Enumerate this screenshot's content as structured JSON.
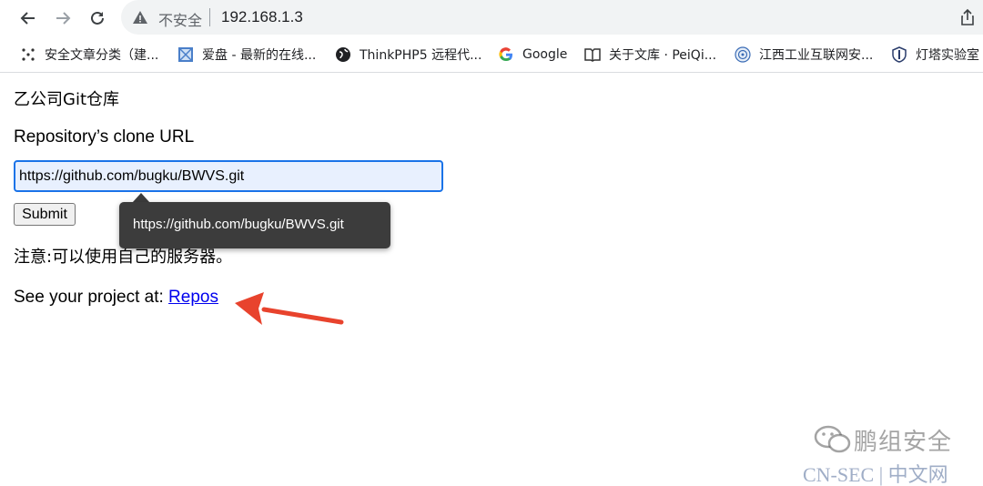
{
  "browser": {
    "security_label": "不安全",
    "address": "192.168.1.3",
    "icons": {
      "back": "arrow-left-icon",
      "forward": "arrow-right-icon",
      "reload": "reload-icon",
      "security": "warning-triangle-icon",
      "share": "share-icon"
    }
  },
  "bookmarks": [
    {
      "label": "安全文章分类（建...",
      "icon": "dots-grid-icon"
    },
    {
      "label": "爱盘 - 最新的在线...",
      "icon": "image-icon"
    },
    {
      "label": "ThinkPHP5 远程代...",
      "icon": "globe-icon"
    },
    {
      "label": "Google",
      "icon": "google-icon"
    },
    {
      "label": "关于文库 · PeiQi...",
      "icon": "book-icon"
    },
    {
      "label": "江西工业互联网安...",
      "icon": "seal-icon"
    },
    {
      "label": "灯塔实验室",
      "icon": "shield-icon"
    }
  ],
  "page": {
    "heading": "乙公司Git仓库",
    "clone_label": "Repository’s clone URL",
    "clone_url": "https://github.com/bugku/BWVS.git",
    "submit_label": "Submit",
    "note": "注意:可以使用自己的服务器。",
    "see_prefix": "See your project at: ",
    "repos_link": "Repos",
    "tooltip": "https://github.com/bugku/BWVS.git"
  },
  "watermark": {
    "brand": "鹏组安全",
    "site": "CN-SEC | 中文网"
  },
  "colors": {
    "link": "#0000ee",
    "input_border": "#1a73e8",
    "input_bg": "#e8f0fe",
    "annotation_arrow": "#e8432d",
    "tooltip_bg": "#3c3c3c"
  }
}
